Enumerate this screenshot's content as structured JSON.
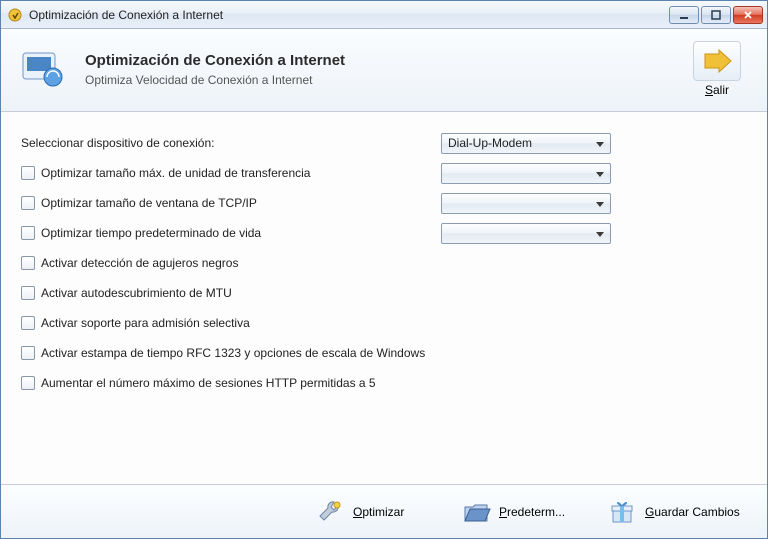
{
  "window": {
    "title": "Optimización de Conexión a Internet"
  },
  "header": {
    "title": "Optimización de Conexión a Internet",
    "subtitle": "Optimiza Velocidad de Conexión a Internet",
    "exit_label": "Salir",
    "exit_underline": "S"
  },
  "form": {
    "device_label": "Seleccionar dispositivo de conexión:",
    "device_value": "Dial-Up-Modem",
    "opts": [
      {
        "label": "Optimizar tamaño máx. de unidad de transferencia",
        "has_select": true,
        "select_value": ""
      },
      {
        "label": "Optimizar tamaño de ventana de TCP/IP",
        "has_select": true,
        "select_value": ""
      },
      {
        "label": "Optimizar tiempo predeterminado de vida",
        "has_select": true,
        "select_value": ""
      },
      {
        "label": "Activar detección de agujeros negros",
        "has_select": false
      },
      {
        "label": "Activar autodescubrimiento de MTU",
        "has_select": false
      },
      {
        "label": "Activar soporte para admisión selectiva",
        "has_select": false
      },
      {
        "label": "Activar estampa de tiempo RFC 1323 y opciones de escala de Windows",
        "has_select": false
      },
      {
        "label": "Aumentar el número máximo de sesiones HTTP permitidas a 5",
        "has_select": false
      }
    ]
  },
  "footer": {
    "optimize": {
      "label": "Optimizar",
      "underline": "O"
    },
    "defaults": {
      "label": "Predeterm...",
      "underline": "P"
    },
    "save": {
      "label": "Guardar Cambios",
      "underline": "G"
    }
  }
}
